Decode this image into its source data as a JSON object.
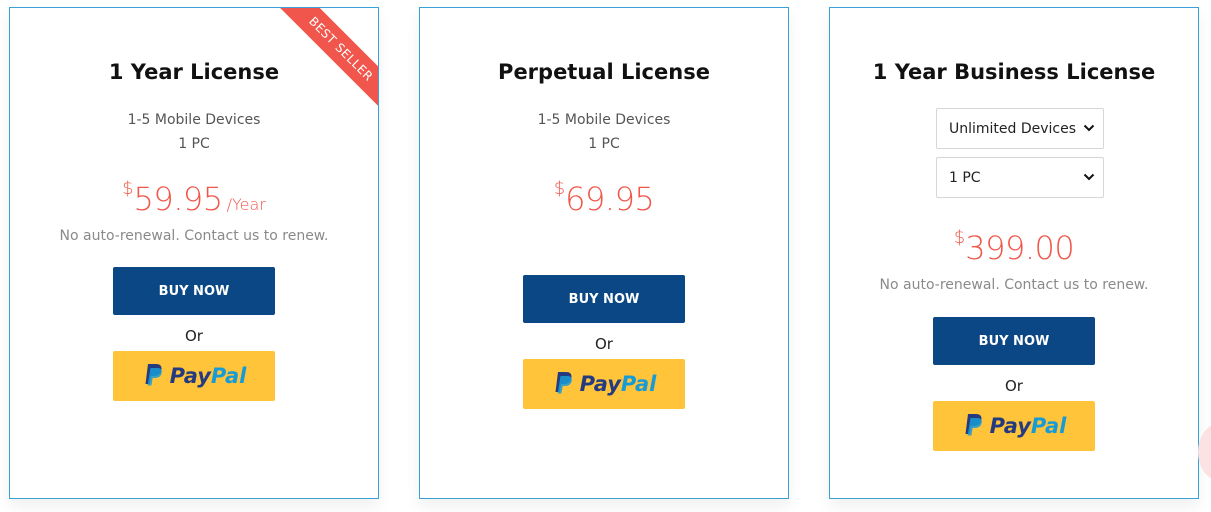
{
  "cards": [
    {
      "title": "1 Year License",
      "features": [
        "1-5 Mobile Devices",
        "1 PC"
      ],
      "currency": "$",
      "price": "59.95",
      "period": "/Year",
      "note": "No auto-renewal. Contact us to renew.",
      "buy_label": "BUY NOW",
      "or_label": "Or",
      "ribbon": "BEST SELLER"
    },
    {
      "title": "Perpetual License",
      "features": [
        "1-5 Mobile Devices",
        "1 PC"
      ],
      "currency": "$",
      "price": "69.95",
      "buy_label": "BUY NOW",
      "or_label": "Or"
    },
    {
      "title": "1 Year Business License",
      "selects": [
        {
          "value": "Unlimited Devices"
        },
        {
          "value": "1 PC"
        }
      ],
      "currency": "$",
      "price": "399.00",
      "note": "No auto-renewal. Contact us to renew.",
      "buy_label": "BUY NOW",
      "or_label": "Or"
    }
  ],
  "paypal": {
    "pay": "Pay",
    "pal": "Pal"
  },
  "colors": {
    "border": "#3aa0d8",
    "price": "#f0574a",
    "button": "#0b4784",
    "paypal_bg": "#ffc439",
    "ribbon": "#f0564b"
  }
}
